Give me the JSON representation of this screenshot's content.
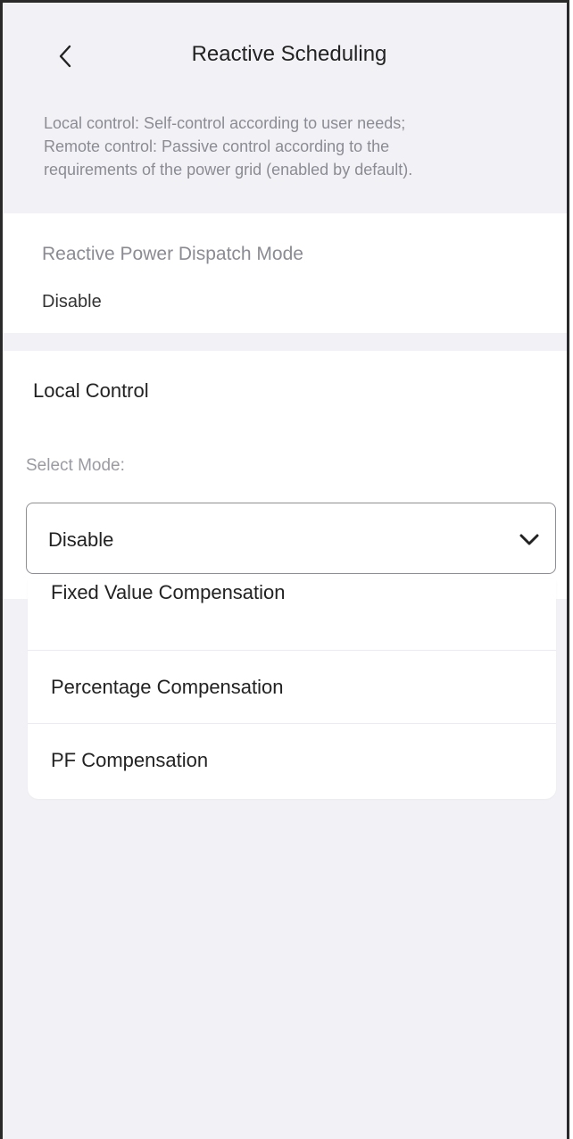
{
  "header": {
    "title": "Reactive Scheduling",
    "back_icon": "chevron-left-icon"
  },
  "info": {
    "lines": [
      "Local control: Self-control according to user needs;",
      "Remote control: Passive control according to the",
      "requirements of the power grid (enabled by default)."
    ]
  },
  "dispatch_mode": {
    "label": "Reactive Power Dispatch Mode",
    "value": "Disable"
  },
  "local_control": {
    "title": "Local Control",
    "select_label": "Select Mode:",
    "selected_value": "Disable",
    "chevron_icon": "chevron-down-icon",
    "options": [
      "Fixed Value Compensation",
      "Percentage Compensation",
      "PF Compensation"
    ]
  },
  "colors": {
    "background": "#f2f2f6",
    "card": "#ffffff",
    "text_primary": "#222222",
    "text_secondary": "#8b8b93"
  }
}
